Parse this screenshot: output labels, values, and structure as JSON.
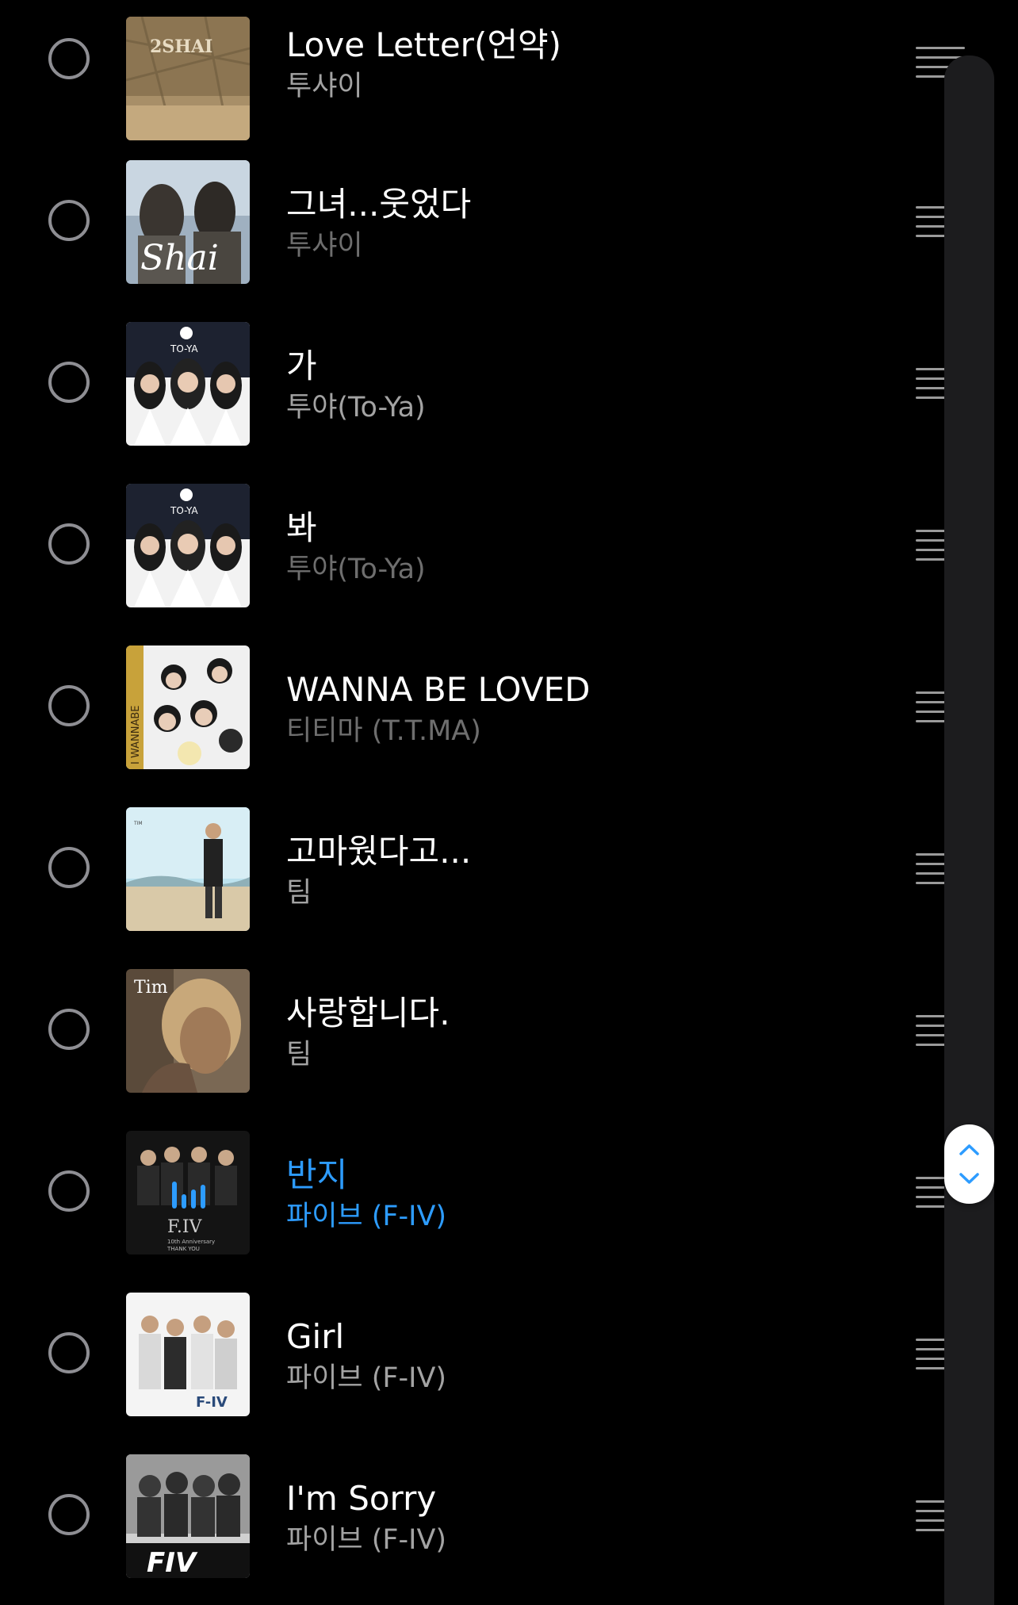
{
  "colors": {
    "background": "#000000",
    "title_text": "#ffffff",
    "artist_text": "#a3a3a3",
    "now_playing_accent": "#2d9cff",
    "scrollbar_track": "#1c1c1e"
  },
  "tracks": [
    {
      "title": "Love Letter(언약)",
      "artist": "투샤이",
      "playing": false
    },
    {
      "title": "그녀...웃었다",
      "artist": "투샤이",
      "playing": false
    },
    {
      "title": "가",
      "artist": "투야(To-Ya)",
      "playing": false
    },
    {
      "title": "봐",
      "artist": "투야(To-Ya)",
      "playing": false
    },
    {
      "title": "WANNA BE LOVED",
      "artist": "티티마 (T.T.MA)",
      "playing": false
    },
    {
      "title": "고마웠다고...",
      "artist": "팀",
      "playing": false
    },
    {
      "title": "사랑합니다.",
      "artist": "팀",
      "playing": false
    },
    {
      "title": "반지",
      "artist": "파이브 (F-IV)",
      "playing": true
    },
    {
      "title": "Girl",
      "artist": "파이브 (F-IV)",
      "playing": false
    },
    {
      "title": "I'm Sorry",
      "artist": "파이브 (F-IV)",
      "playing": false
    }
  ],
  "album_art": {
    "shai_logo": "2SHAI",
    "shai_script": "Shai",
    "toya_logo": "TO-YA",
    "ttma_logo": "I WANNABE",
    "tim_logo": "Tim",
    "fiv_logo": "F.IV",
    "fiv_caption": "10th Anniversary",
    "fiv_caption2": "THANK YOU",
    "fiv_logo2": "F-IV",
    "fiv_logo3": "FIV"
  },
  "icons": {
    "select": "radio-circle-icon",
    "reorder": "drag-handle-icon",
    "now_playing": "equalizer-bars-icon",
    "scroll_up": "chevron-up-icon",
    "scroll_down": "chevron-down-icon"
  }
}
